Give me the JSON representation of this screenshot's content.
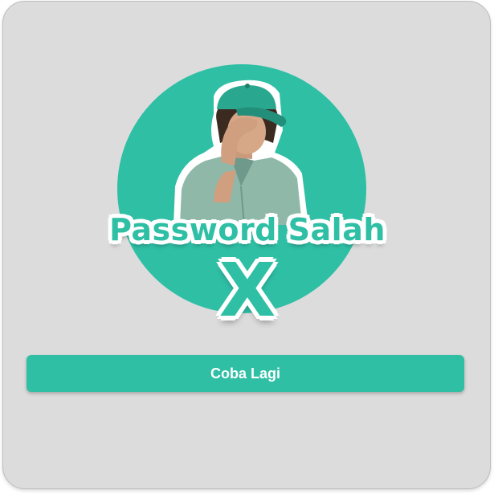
{
  "dialog": {
    "title": "Password Salah",
    "mark": "X",
    "retry_label": "Coba Lagi"
  },
  "colors": {
    "accent": "#2ebfa5",
    "card_background": "#dcdcdc",
    "button_text": "#ffffff"
  },
  "icons": {
    "illustration": "frustrated-man-facepalm-illustration"
  }
}
